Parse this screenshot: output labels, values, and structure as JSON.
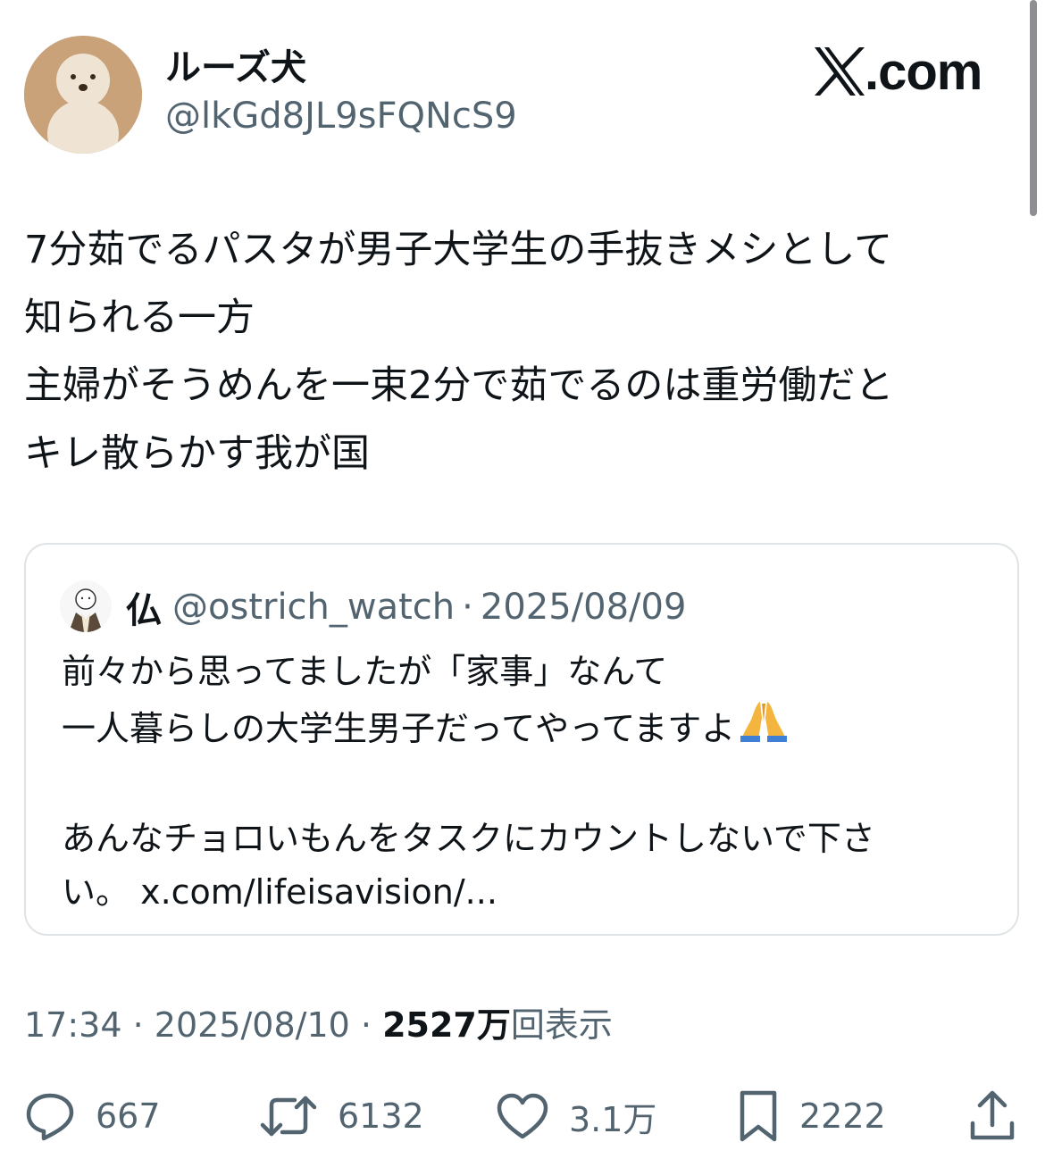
{
  "author": {
    "name": "ルーズ犬",
    "handle": "@lkGd8JL9sFQNcS9"
  },
  "brand": {
    "label": ".com"
  },
  "post": {
    "lines": [
      "7分茹でるパスタが男子大学生の手抜きメシとして",
      "知られる一方",
      "主婦がそうめんを一束2分で茹でるのは重労働だと",
      "キレ散らかす我が国"
    ]
  },
  "quote": {
    "name": "仏",
    "handle": "@ostrich_watch",
    "separator": "·",
    "date": "2025/08/09",
    "lines": [
      "前々から思ってましたが「家事」なんて",
      "一人暮らしの大学生男子だってやってますよ",
      "",
      "あんなチョロいもんをタスクにカウントしないで下さ",
      "い。 x.com/lifeisavision/..."
    ]
  },
  "meta": {
    "time": "17:34",
    "separator": "·",
    "date": "2025/08/10",
    "views_count": "2527万",
    "views_label": "回表示"
  },
  "actions": {
    "replies": "667",
    "reposts": "6132",
    "likes": "3.1万",
    "bookmarks": "2222"
  },
  "colors": {
    "text": "#0f1419",
    "secondary": "#536471",
    "border": "#dfe3e6"
  }
}
